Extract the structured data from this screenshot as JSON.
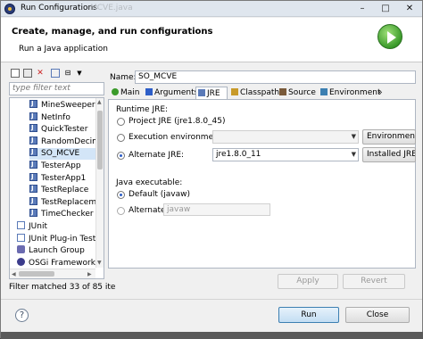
{
  "window": {
    "title": "Run Configurations",
    "title_ghost": "MCVE.java",
    "minimize": "–",
    "maximize": "□",
    "close": "✕"
  },
  "header": {
    "title": "Create, manage, and run configurations",
    "subtitle": "Run a Java application",
    "run_icon": "run-launch-icon"
  },
  "left": {
    "toolbar_icons": [
      "new-config-icon",
      "duplicate-icon",
      "delete-icon",
      "filter-icon",
      "collapse-all-icon",
      "view-menu-icon"
    ],
    "filter_placeholder": "type filter text",
    "tree": [
      {
        "label": "MineSweeper",
        "icon": "java-app-icon",
        "selected": false
      },
      {
        "label": "NetInfo",
        "icon": "java-app-icon",
        "selected": false
      },
      {
        "label": "QuickTester",
        "icon": "java-app-icon",
        "selected": false
      },
      {
        "label": "RandomDecimal",
        "icon": "java-app-icon",
        "selected": false
      },
      {
        "label": "SO_MCVE",
        "icon": "java-app-icon",
        "selected": true
      },
      {
        "label": "TesterApp",
        "icon": "java-app-icon",
        "selected": false
      },
      {
        "label": "TesterApp1",
        "icon": "java-app-icon",
        "selected": false
      },
      {
        "label": "TestReplace",
        "icon": "java-app-icon",
        "selected": false
      },
      {
        "label": "TestReplacemen",
        "icon": "java-app-icon",
        "selected": false
      },
      {
        "label": "TimeChecker",
        "icon": "java-app-icon",
        "selected": false
      },
      {
        "label": "JUnit",
        "icon": "junit-icon",
        "selected": false
      },
      {
        "label": "JUnit Plug-in Test",
        "icon": "junit-plugin-icon",
        "selected": false
      },
      {
        "label": "Launch Group",
        "icon": "launch-group-icon",
        "selected": false
      },
      {
        "label": "OSGi Framework",
        "icon": "osgi-icon",
        "selected": false
      }
    ],
    "filter_status": "Filter matched 33 of 85 ite"
  },
  "right": {
    "name_label": "Name:",
    "name_value": "SO_MCVE",
    "tabs": [
      {
        "label": "Main",
        "icon": "main-tab-icon",
        "active": false
      },
      {
        "label": "Arguments",
        "icon": "arguments-tab-icon",
        "active": false
      },
      {
        "label": "JRE",
        "icon": "jre-tab-icon",
        "active": true
      },
      {
        "label": "Classpath",
        "icon": "classpath-tab-icon",
        "active": false
      },
      {
        "label": "Source",
        "icon": "source-tab-icon",
        "active": false
      },
      {
        "label": "Environment",
        "icon": "environment-tab-icon",
        "active": false
      },
      {
        "label": "»",
        "icon": "more-tabs-icon",
        "active": false
      }
    ],
    "runtime_jre_title": "Runtime JRE:",
    "project_jre_label": "Project JRE (jre1.8.0_45)",
    "exec_env_label": "Execution environment:",
    "exec_env_value": "",
    "exec_env_button": "Environment",
    "alt_jre_label": "Alternate JRE:",
    "alt_jre_value": "jre1.8.0_11",
    "installed_jre_button": "Installed JRE",
    "java_exec_title": "Java executable:",
    "default_label": "Default (javaw)",
    "alternate_label": "Alternate",
    "alternate_value": "javaw",
    "apply_button": "Apply",
    "revert_button": "Revert"
  },
  "footer": {
    "help": "?",
    "run_button": "Run",
    "close_button": "Close"
  }
}
